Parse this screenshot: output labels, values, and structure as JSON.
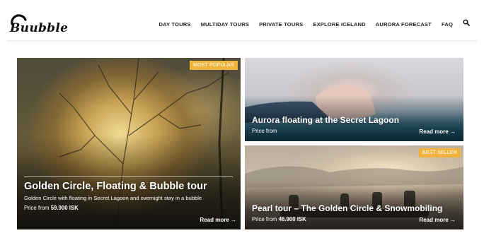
{
  "brand": {
    "name": "Buubble"
  },
  "nav": {
    "items": [
      "DAY TOURS",
      "MULTIDAY TOURS",
      "PRIVATE TOURS",
      "EXPLORE ICELAND",
      "AURORA FORECAST",
      "FAQ"
    ],
    "search_icon": "search-icon"
  },
  "tours": {
    "main": {
      "badge": "MOST POPULAR",
      "title": "Golden Circle, Floating & Bubble tour",
      "subtitle": "Golden Circle with floating in Secret Lagoon and overnight stay in a bubble",
      "price_label": "Price from",
      "price_value": "59.900 ISK",
      "read_more": "Read more →"
    },
    "top": {
      "title": "Aurora floating at the Secret Lagoon",
      "price_label": "Price from",
      "read_more": "Read more →"
    },
    "bottom": {
      "badge": "BEST SELLER",
      "title": "Pearl tour – The Golden Circle & Snowmobiling",
      "price_label": "Price from",
      "price_value": "46.900 ISK",
      "read_more": "Read more →"
    }
  },
  "colors": {
    "badge": "#f1b53e",
    "text": "#222222",
    "background": "#ffffff"
  }
}
